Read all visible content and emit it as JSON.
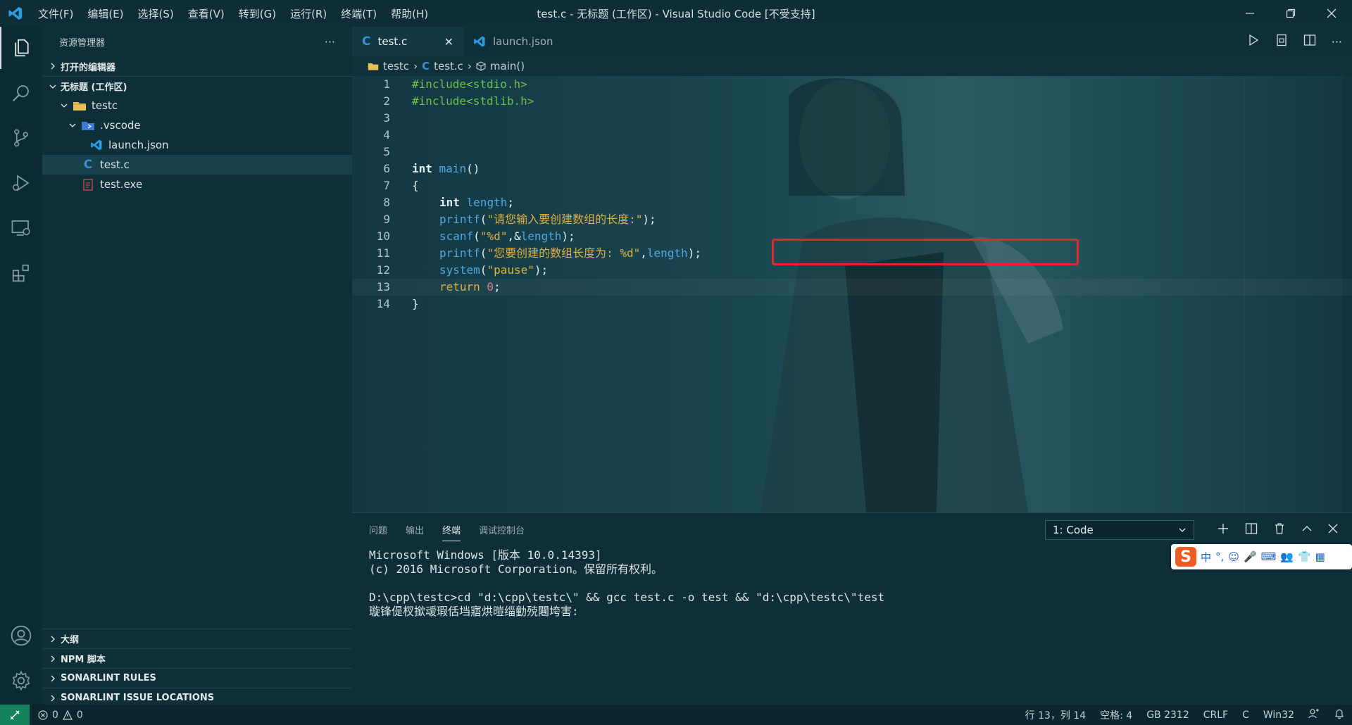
{
  "titlebar": {
    "menus": [
      "文件(F)",
      "编辑(E)",
      "选择(S)",
      "查看(V)",
      "转到(G)",
      "运行(R)",
      "终端(T)",
      "帮助(H)"
    ],
    "title": "test.c - 无标题 (工作区) - Visual Studio Code [不受支持]"
  },
  "sidebar": {
    "header": "资源管理器",
    "more": "···",
    "open_editors": "打开的编辑器",
    "workspace": "无标题 (工作区)",
    "tree": {
      "folder": "testc",
      "vscode": ".vscode",
      "launch": "launch.json",
      "testc_file": "test.c",
      "testexe": "test.exe"
    },
    "bottom": [
      "大纲",
      "NPM 脚本",
      "SONARLINT RULES",
      "SONARLINT ISSUE LOCATIONS"
    ]
  },
  "tabs": [
    {
      "label": "test.c",
      "icon": "C",
      "close": "✕"
    },
    {
      "label": "launch.json"
    }
  ],
  "breadcrumb": {
    "folder": "testc",
    "file": "test.c",
    "symbol": "main()"
  },
  "code": {
    "line_numbers": [
      "1",
      "2",
      "3",
      "4",
      "5",
      "6",
      "7",
      "8",
      "9",
      "10",
      "11",
      "12",
      "13",
      "14"
    ],
    "l1_a": "#include",
    "l1_b": "<stdio.h>",
    "l2_a": "#include",
    "l2_b": "<stdlib.h>",
    "l6_a": "int",
    "l6_b": " main",
    "l6_c": "()",
    "l7": "{",
    "l8_a": "int",
    "l8_b": " length",
    "l8_c": ";",
    "l9_a": "printf",
    "l9_b": "(",
    "l9_c": "\"请您输入要创建数组的长度:\"",
    "l9_d": ");",
    "l10_a": "scanf",
    "l10_b": "(",
    "l10_c": "\"%d\"",
    "l10_d": ",&",
    "l10_e": "length",
    "l10_f": ");",
    "l11_a": "printf",
    "l11_b": "(",
    "l11_c": "\"您要创建的数组长度为: %d\"",
    "l11_d": ",",
    "l11_e": "length",
    "l11_f": ");",
    "l12_a": "system",
    "l12_b": "(",
    "l12_c": "\"pause\"",
    "l12_d": ");",
    "l13_a": "return",
    "l13_b": " 0",
    "l13_c": ";",
    "l14": "}"
  },
  "panel": {
    "tabs": [
      "问题",
      "输出",
      "终端",
      "调试控制台"
    ],
    "terminal_select": "1: Code",
    "terminal_lines": [
      "Microsoft Windows [版本 10.0.14393]",
      "(c) 2016 Microsoft Corporation。保留所有权利。",
      "",
      "D:\\cpp\\testc>cd \"d:\\cpp\\testc\\\" && gcc test.c -o test && \"d:\\cpp\\testc\\\"test",
      "璇锋偍杈撳叆瑕佸垱寤烘暟缁勭殑闀垮害:"
    ]
  },
  "ime": {
    "logo": "S",
    "items": [
      "中",
      "°,",
      "☺",
      "🎤",
      "⌨",
      "👥",
      "👕",
      "▦"
    ]
  },
  "statusbar": {
    "errors": "0",
    "warnings": "0",
    "position": "行 13，列 14",
    "spaces": "空格: 4",
    "encoding": "GB 2312",
    "eol": "CRLF",
    "language": "C",
    "platform": "Win32"
  },
  "colors": {
    "accent_red": "#e0282c",
    "remote_green": "#16825d"
  }
}
